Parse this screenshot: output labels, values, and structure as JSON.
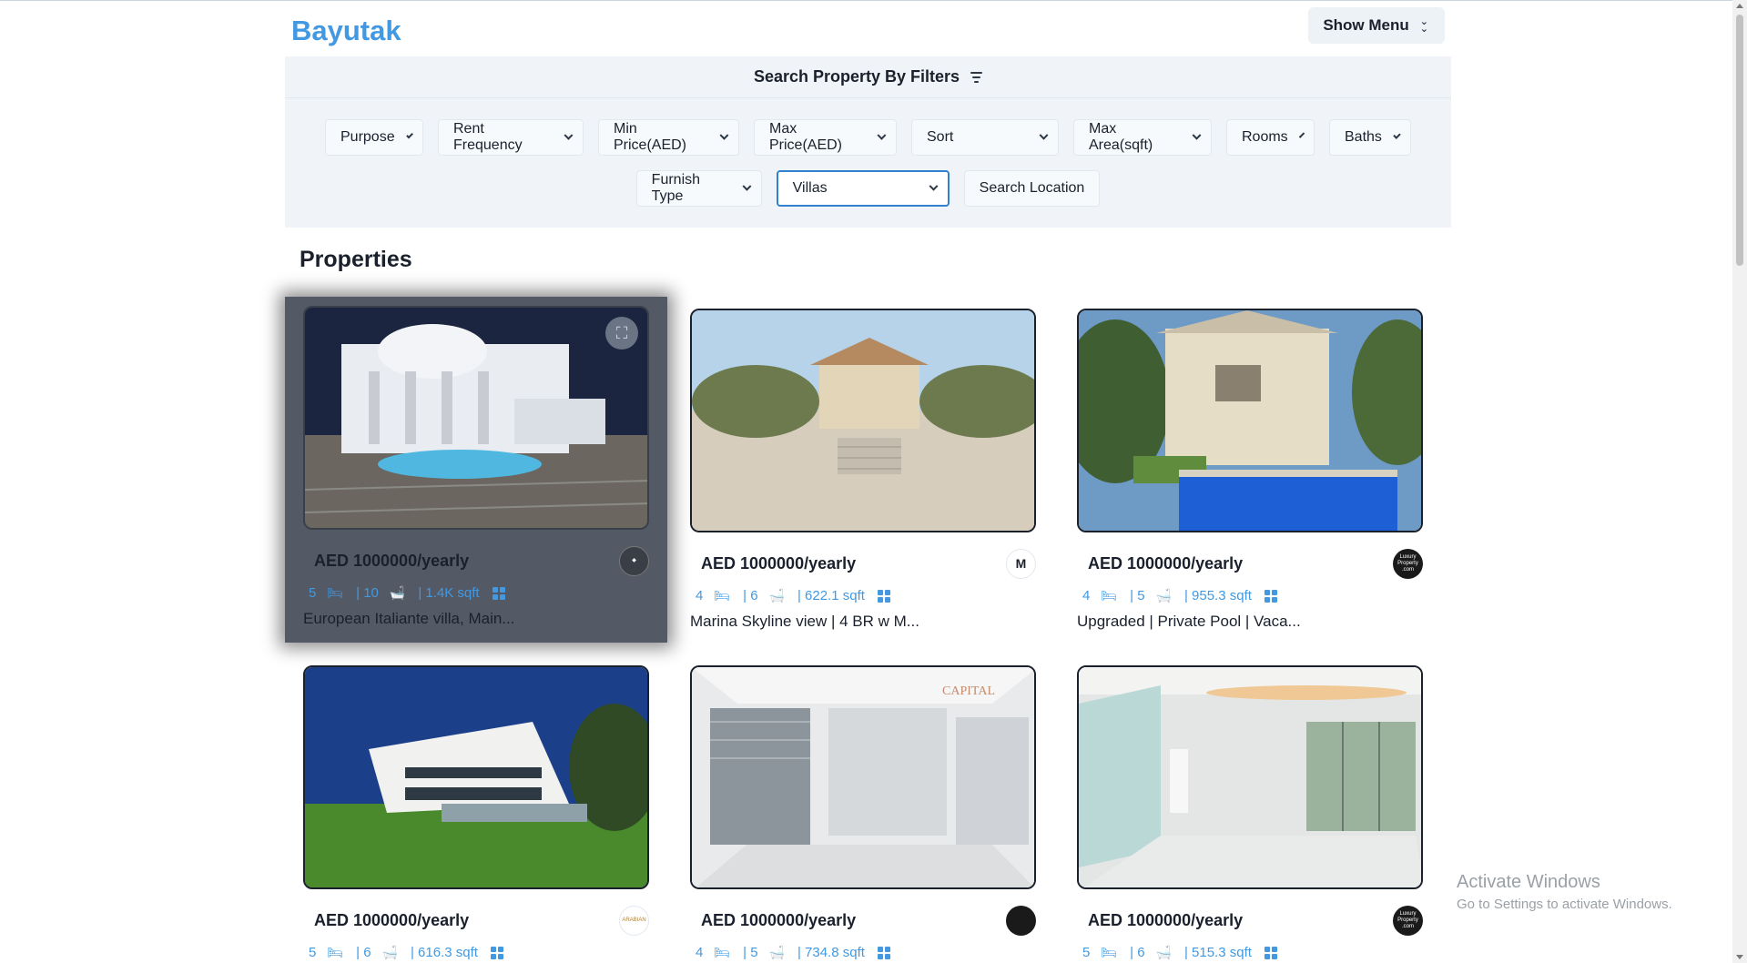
{
  "app": {
    "logo": "Bayutak",
    "menu_button": "Show Menu"
  },
  "filters": {
    "title": "Search Property By Filters",
    "row1": [
      "Purpose",
      "Rent Frequency",
      "Min Price(AED)",
      "Max Price(AED)",
      "Sort",
      "Max Area(sqft)",
      "Rooms",
      "Baths"
    ],
    "furnish": "Furnish Type",
    "category": "Villas",
    "search_location": "Search Location"
  },
  "section_title": "Properties",
  "cards": [
    {
      "price": "AED 1000000/yearly",
      "rooms": "5",
      "baths": "| 10",
      "area": "| 1.4K sqft",
      "title": "European Italiante villa, Main...",
      "agent": "◆"
    },
    {
      "price": "AED 1000000/yearly",
      "rooms": "4",
      "baths": "| 6",
      "area": "| 622.1 sqft",
      "title": "Marina Skyline view | 4 BR w M...",
      "agent": "M"
    },
    {
      "price": "AED 1000000/yearly",
      "rooms": "4",
      "baths": "| 5",
      "area": "| 955.3 sqft",
      "title": "Upgraded | Private Pool | Vaca...",
      "agent": "Luxury Property .com"
    },
    {
      "price": "AED 1000000/yearly",
      "rooms": "5",
      "baths": "| 6",
      "area": "| 616.3 sqft",
      "title": "",
      "agent": "ARABIAN"
    },
    {
      "price": "AED 1000000/yearly",
      "rooms": "4",
      "baths": "| 5",
      "area": "| 734.8 sqft",
      "title": "",
      "agent": ""
    },
    {
      "price": "AED 1000000/yearly",
      "rooms": "5",
      "baths": "| 6",
      "area": "| 515.3 sqft",
      "title": "",
      "agent": "Luxury Property .com"
    }
  ],
  "watermark": {
    "line1": "Activate Windows",
    "line2": "Go to Settings to activate Windows."
  },
  "colors": {
    "accent": "#4299e1",
    "panel": "#f0f4f8",
    "highlight_card": "#535a66"
  }
}
